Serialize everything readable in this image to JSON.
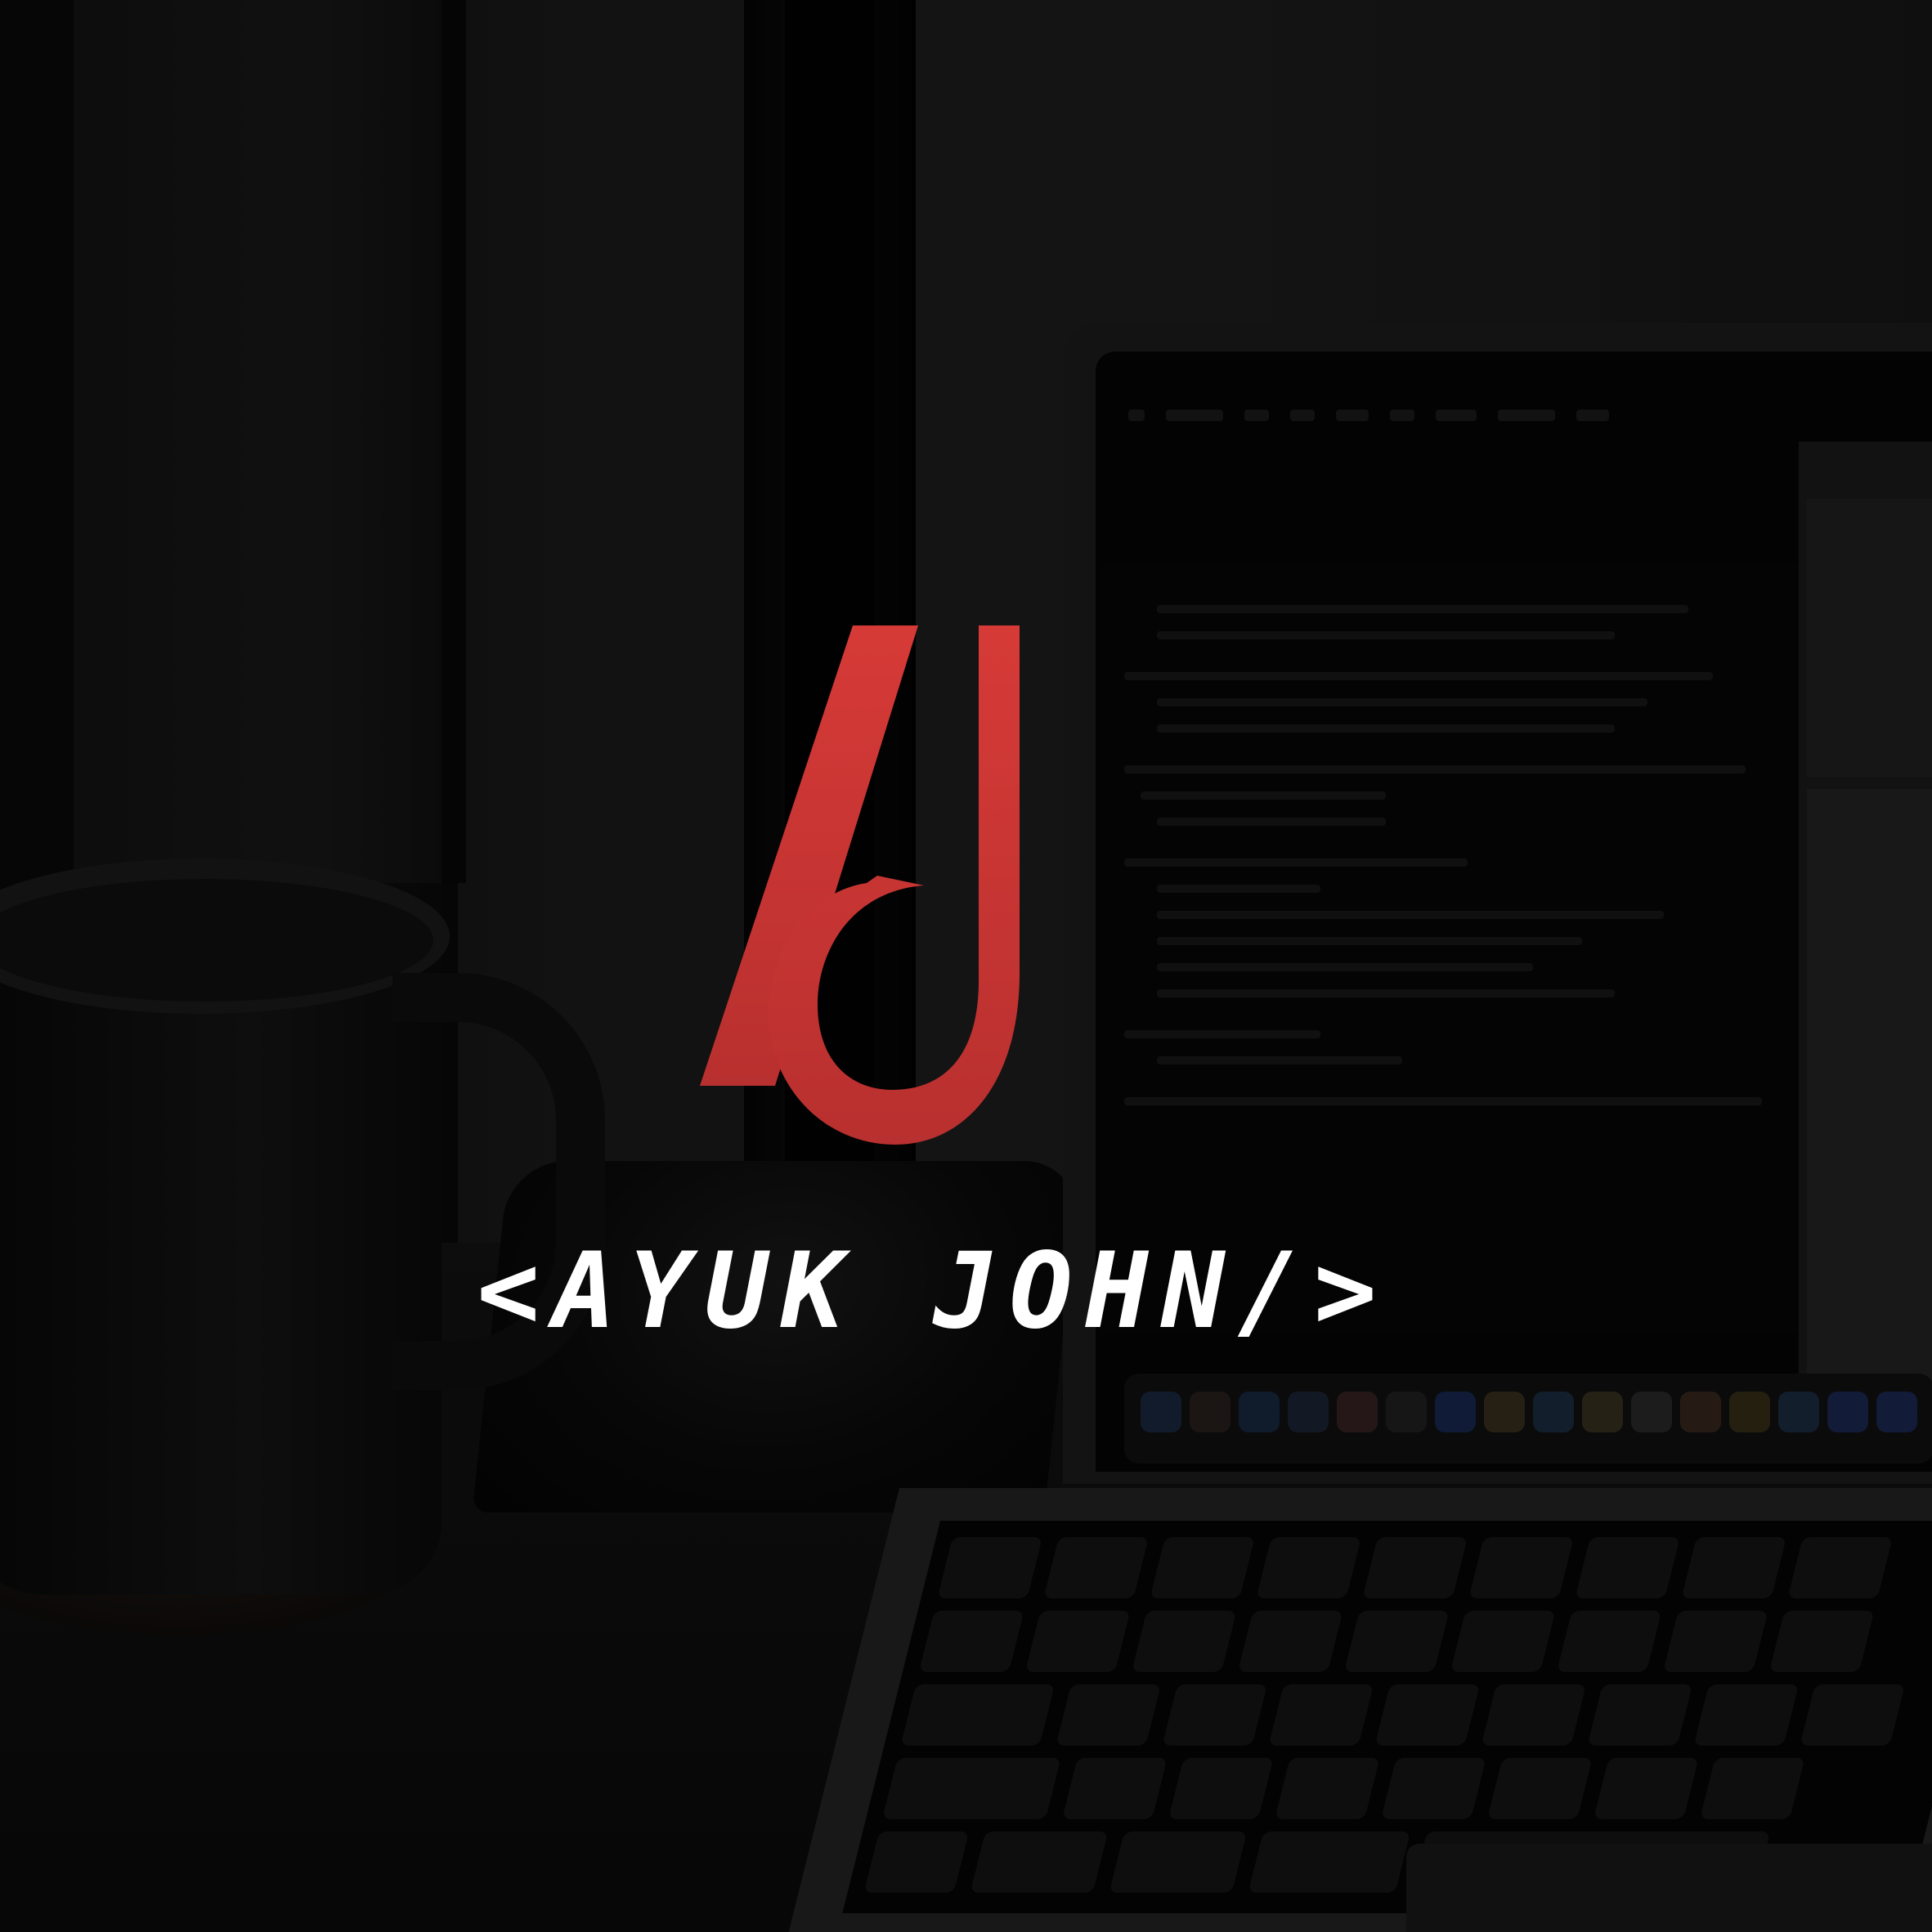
{
  "brand": {
    "wordmark": "<AYUK JOHN/>",
    "logo_icon": "aj-monogram-logo",
    "colors": {
      "logo_red": "#d63a37",
      "logo_red_dark": "#b8302f",
      "wordmark_white": "#ffffff",
      "background": "#0e0e0e"
    }
  },
  "background_scene": {
    "items": [
      "coffee-mug-icon",
      "desk-lamp-icon",
      "laptop-icon"
    ]
  }
}
